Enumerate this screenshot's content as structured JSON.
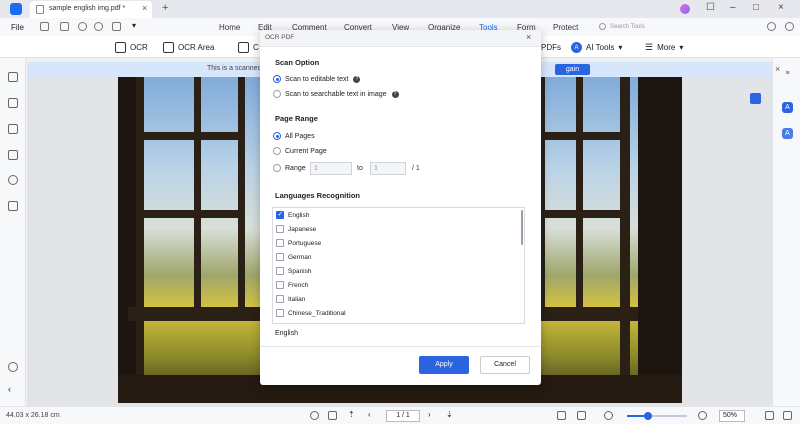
{
  "titlebar": {
    "tab_title": "sample english img.pdf *",
    "tab_close": "×",
    "new_tab": "+",
    "minimize": "–",
    "maximize": "□",
    "close": "×"
  },
  "menubar": {
    "file": "File",
    "items": [
      "Home",
      "Edit",
      "Comment",
      "Convert",
      "View",
      "Organize",
      "Tools",
      "Form",
      "Protect"
    ],
    "active": "Tools",
    "search_placeholder": "Search Tools"
  },
  "toolbar": {
    "ocr": "OCR",
    "ocr_area": "OCR Area",
    "c_partial": "C",
    "pdfs_partial": "PDFs",
    "ai_tools": "AI Tools",
    "ai_tools_chevron": "▾",
    "more": "More",
    "more_chevron": "▾",
    "menu_glyph": "☰"
  },
  "banner": {
    "text": "This is a scanned",
    "button": "gain",
    "close": "×"
  },
  "modal": {
    "title": "OCR PDF",
    "close": "×",
    "scan_option_title": "Scan Option",
    "scan_options": [
      "Scan to editable text",
      "Scan to searchable text in image"
    ],
    "scan_selected": 0,
    "help_glyph": "?",
    "page_range_title": "Page Range",
    "page_options": [
      "All Pages",
      "Current Page",
      "Range"
    ],
    "page_selected": 0,
    "range_from": "1",
    "range_to_label": "to",
    "range_to": "1",
    "range_total": "/ 1",
    "languages_title": "Languages Recognition",
    "languages": [
      {
        "name": "English",
        "checked": true
      },
      {
        "name": "Japanese",
        "checked": false
      },
      {
        "name": "Portuguese",
        "checked": false
      },
      {
        "name": "German",
        "checked": false
      },
      {
        "name": "Spanish",
        "checked": false
      },
      {
        "name": "French",
        "checked": false
      },
      {
        "name": "Italian",
        "checked": false
      },
      {
        "name": "Chinese_Traditional",
        "checked": false
      }
    ],
    "selected_languages": "English",
    "apply": "Apply",
    "cancel": "Cancel"
  },
  "statusbar": {
    "dimensions": "44.03 x 26.18 cm",
    "page": "1 / 1",
    "zoom": "50%",
    "zoom_level": 0.35
  },
  "colors": {
    "accent": "#2a64e0",
    "banner_bg": "#d8e6fb"
  }
}
